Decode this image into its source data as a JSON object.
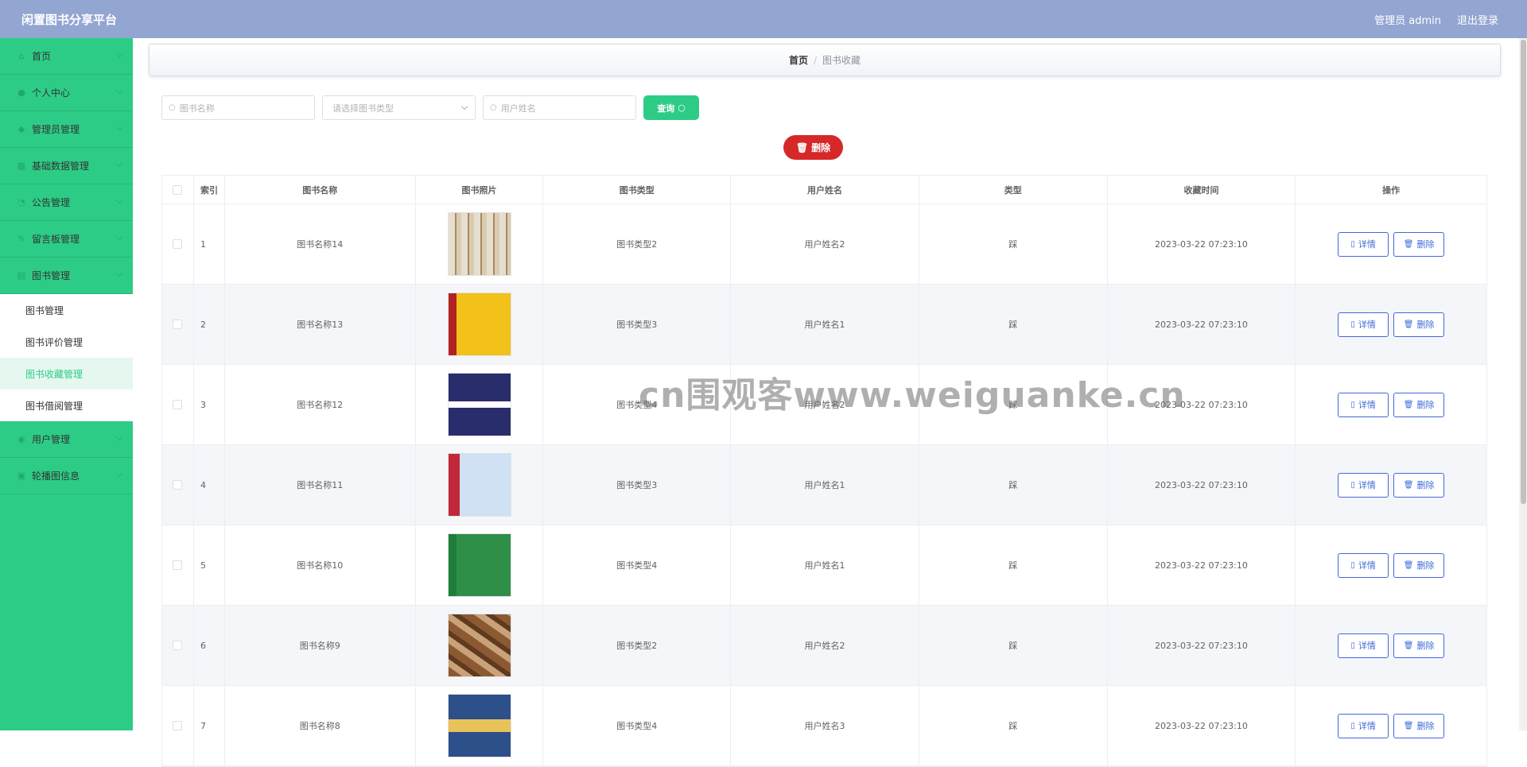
{
  "app": {
    "title": "闲置图书分享平台",
    "user_label": "管理员 admin",
    "logout_label": "退出登录"
  },
  "sidebar": {
    "items": [
      {
        "label": "首页",
        "icon": "home-icon"
      },
      {
        "label": "个人中心",
        "icon": "user-icon"
      },
      {
        "label": "管理员管理",
        "icon": "admin-icon"
      },
      {
        "label": "基础数据管理",
        "icon": "data-icon"
      },
      {
        "label": "公告管理",
        "icon": "notice-icon"
      },
      {
        "label": "留言板管理",
        "icon": "message-icon"
      },
      {
        "label": "图书管理",
        "icon": "book-icon"
      }
    ],
    "sub_items": [
      {
        "label": "图书管理",
        "active": false
      },
      {
        "label": "图书评价管理",
        "active": false
      },
      {
        "label": "图书收藏管理",
        "active": true
      },
      {
        "label": "图书借阅管理",
        "active": false
      }
    ],
    "after_items": [
      {
        "label": "用户管理",
        "icon": "users-icon"
      },
      {
        "label": "轮播图信息",
        "icon": "carousel-icon"
      }
    ]
  },
  "breadcrumb": {
    "home": "首页",
    "separator": "/",
    "current": "图书收藏"
  },
  "search": {
    "book_name_placeholder": "图书名称",
    "book_type_placeholder": "请选择图书类型",
    "user_name_placeholder": "用户姓名",
    "query_label": "查询"
  },
  "toolbar": {
    "delete_label": "删除"
  },
  "table": {
    "headers": [
      "索引",
      "图书名称",
      "图书照片",
      "图书类型",
      "用户姓名",
      "类型",
      "收藏时间",
      "操作"
    ],
    "detail_label": "详情",
    "delete_label": "删除",
    "rows": [
      {
        "index": "1",
        "name": "图书名称14",
        "type": "图书类型2",
        "user": "用户姓名2",
        "kind": "踩",
        "time": "2023-03-22 07:23:10",
        "cover": "box-set"
      },
      {
        "index": "2",
        "name": "图书名称13",
        "type": "图书类型3",
        "user": "用户姓名1",
        "kind": "踩",
        "time": "2023-03-22 07:23:10",
        "cover": "yellow-book"
      },
      {
        "index": "3",
        "name": "图书名称12",
        "type": "图书类型4",
        "user": "用户姓名2",
        "kind": "踩",
        "time": "2023-03-22 07:23:10",
        "cover": "night-book"
      },
      {
        "index": "4",
        "name": "图书名称11",
        "type": "图书类型3",
        "user": "用户姓名1",
        "kind": "踩",
        "time": "2023-03-22 07:23:10",
        "cover": "red-book"
      },
      {
        "index": "5",
        "name": "图书名称10",
        "type": "图书类型4",
        "user": "用户姓名1",
        "kind": "踩",
        "time": "2023-03-22 07:23:10",
        "cover": "green-book"
      },
      {
        "index": "6",
        "name": "图书名称9",
        "type": "图书类型2",
        "user": "用户姓名2",
        "kind": "踩",
        "time": "2023-03-22 07:23:10",
        "cover": "stack-photo"
      },
      {
        "index": "7",
        "name": "图书名称8",
        "type": "图书类型4",
        "user": "用户姓名3",
        "kind": "踩",
        "time": "2023-03-22 07:23:10",
        "cover": "romance-book"
      }
    ]
  },
  "watermark": "cn围观客www.weiguanke.cn",
  "colors": {
    "topbar": "#93a5d1",
    "sidebar": "#2dcc86",
    "accent": "#2dcc86",
    "danger": "#d62828",
    "link": "#3f6ad8"
  }
}
